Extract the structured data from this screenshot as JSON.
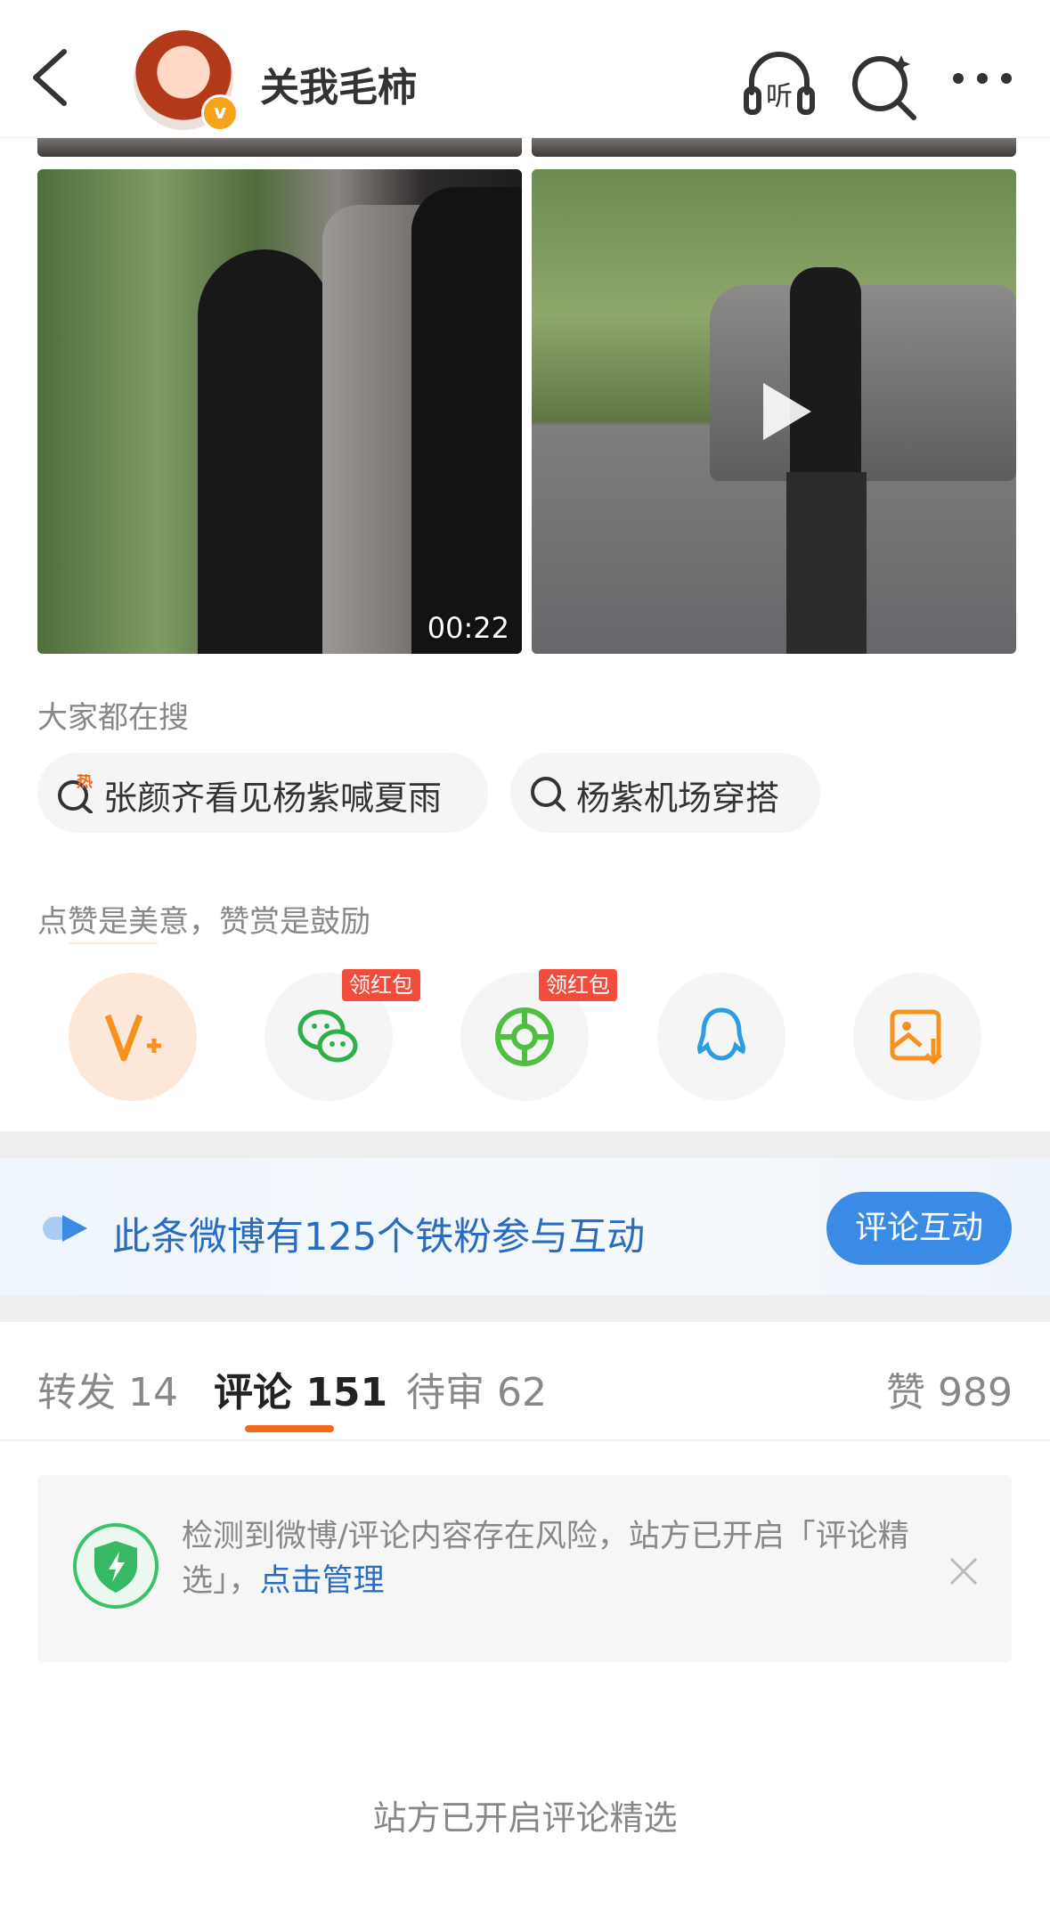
{
  "header": {
    "username": "关我毛柿",
    "verified_badge": "v",
    "icons": [
      "back-icon",
      "listen-icon",
      "search-icon",
      "more-icon"
    ],
    "listen_label": "听"
  },
  "videos": [
    {
      "duration": "00:22"
    },
    {
      "duration": ""
    }
  ],
  "search": {
    "title": "大家都在搜",
    "pills": [
      {
        "label": "张颜齐看见杨紫喊夏雨",
        "hot_label": "热"
      },
      {
        "label": "杨紫机场穿搭"
      }
    ]
  },
  "share": {
    "title": "点赞是美意，赞赏是鼓励",
    "items": [
      {
        "icon": "reward-v-icon"
      },
      {
        "icon": "wechat-icon",
        "tag": "领红包"
      },
      {
        "icon": "moments-icon",
        "tag": "领红包"
      },
      {
        "icon": "qq-icon"
      },
      {
        "icon": "save-image-icon"
      }
    ]
  },
  "banner": {
    "text": "此条微博有125个铁粉参与互动",
    "button": "评论互动"
  },
  "tabs": {
    "repost": "转发 14",
    "comment": "评论 151",
    "pending": "待审 62",
    "like": "赞 989"
  },
  "notice": {
    "text": "检测到微博/评论内容存在风险，站方已开启「评论精选」，",
    "link": "点击管理"
  },
  "footer_note": "站方已开启评论精选",
  "colors": {
    "accent_orange": "#f06a1c",
    "link_blue": "#2c6cbf",
    "button_blue": "#3a8be5",
    "tag_red": "#f24c3d"
  }
}
